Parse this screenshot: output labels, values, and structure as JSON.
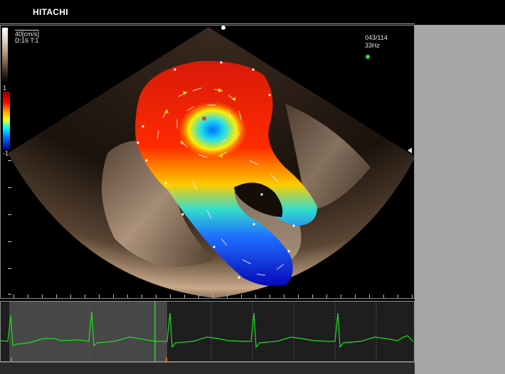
{
  "header": {
    "brand": "HITACHI"
  },
  "viewport": {
    "velocity_scale": "40[cm/s]",
    "display_params": "D:16 T:1",
    "colorbar_max": "1",
    "colorbar_min": "-1",
    "frame_counter": "043/114",
    "frame_rate": "33Hz"
  },
  "colors": {
    "ecg_trace": "#22dd22",
    "live_indicator": "#22dd44",
    "side_panel": "#a6a6a6",
    "flow_high": "#ff0000",
    "flow_low": "#0000cc"
  },
  "icons": {
    "probe_marker": "probe-marker-icon",
    "focus_marker": "focus-marker-icon",
    "live_indicator": "live-indicator-icon"
  },
  "ecg": {
    "highlighted_fraction": 0.38
  }
}
